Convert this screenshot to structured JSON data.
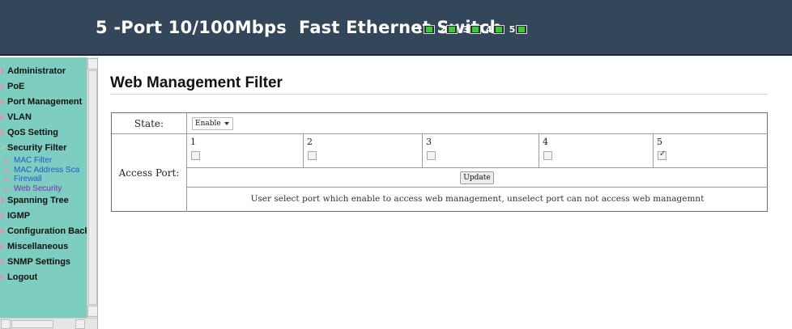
{
  "header": {
    "title_prefix": "5 -Port 10/100Mbps",
    "title_suffix": "Fast Ethernet Switch",
    "port_indicators": [
      {
        "number": "1",
        "status_color": "#39c83a"
      },
      {
        "number": "2",
        "status_color": "#39c83a"
      },
      {
        "number": "3",
        "status_color": "#39c83a"
      },
      {
        "number": "4",
        "status_color": "#39c83a"
      },
      {
        "number": "5",
        "status_color": "#39c83a"
      }
    ]
  },
  "sidebar": {
    "items": [
      {
        "label": "Administrator",
        "icon": "arrow-right-icon"
      },
      {
        "label": "PoE",
        "icon": "arrow-right-icon"
      },
      {
        "label": "Port Management",
        "icon": "arrow-right-icon"
      },
      {
        "label": "VLAN",
        "icon": "arrow-right-icon"
      },
      {
        "label": "QoS Setting",
        "icon": "arrow-right-icon"
      },
      {
        "label": "Security Filter",
        "icon": "check-icon"
      },
      {
        "label": "Spanning Tree",
        "icon": "arrow-right-icon"
      },
      {
        "label": "IGMP",
        "icon": "arrow-right-icon"
      },
      {
        "label": "Configuration Back",
        "icon": "arrow-right-icon"
      },
      {
        "label": "Miscellaneous",
        "icon": "arrow-right-icon"
      },
      {
        "label": "SNMP Settings",
        "icon": "arrow-right-icon"
      },
      {
        "label": "Logout",
        "icon": "arrow-right-icon"
      }
    ],
    "security_subitems": [
      {
        "label": "MAC Filter"
      },
      {
        "label": "MAC Address Sca"
      },
      {
        "label": "Firewall"
      },
      {
        "label": "Web Security"
      }
    ],
    "colors": {
      "background": "#7dcdc1",
      "link": "#2257c7",
      "visited": "#7a2ab3",
      "bullet": "#e58fb4"
    }
  },
  "main": {
    "title": "Web Management Filter",
    "state_label": "State:",
    "state_value": "Enable",
    "access_label": "Access Port:",
    "ports": [
      {
        "number": "1",
        "checked": false
      },
      {
        "number": "2",
        "checked": false
      },
      {
        "number": "3",
        "checked": false
      },
      {
        "number": "4",
        "checked": false
      },
      {
        "number": "5",
        "checked": true
      }
    ],
    "update_label": "Update",
    "note": "User select port which enable to access web management, unselect port can not access web managemnt"
  }
}
